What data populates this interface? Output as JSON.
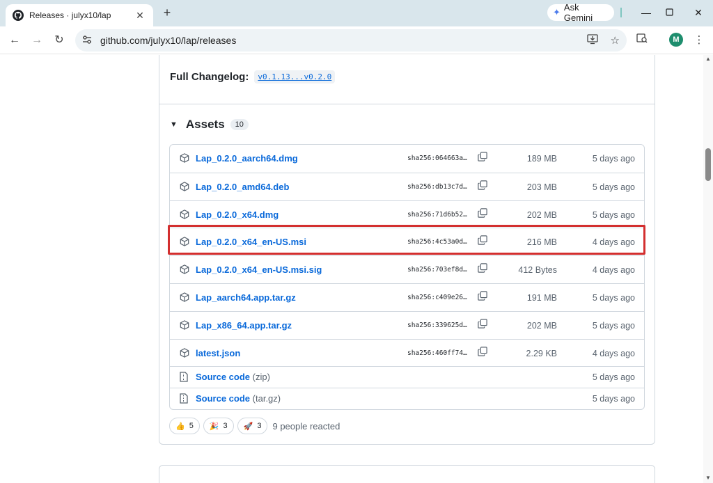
{
  "browser": {
    "tab_title": "Releases · julyx10/lap",
    "tab_close": "✕",
    "new_tab": "+",
    "ask_gemini": "Ask Gemini",
    "url": "github.com/julyx10/lap/releases",
    "avatar_letter": "M"
  },
  "release": {
    "cut_text": "",
    "changelog_label": "Full Changelog:",
    "changelog_link": "v0.1.13...v0.2.0",
    "assets_title": "Assets",
    "assets_count": "10",
    "assets": [
      {
        "name": "Lap_0.2.0_aarch64.dmg",
        "sha": "sha256:064663a…",
        "size": "189 MB",
        "date": "5 days ago"
      },
      {
        "name": "Lap_0.2.0_amd64.deb",
        "sha": "sha256:db13c7d…",
        "size": "203 MB",
        "date": "5 days ago"
      },
      {
        "name": "Lap_0.2.0_x64.dmg",
        "sha": "sha256:71d6b52…",
        "size": "202 MB",
        "date": "5 days ago"
      },
      {
        "name": "Lap_0.2.0_x64_en-US.msi",
        "sha": "sha256:4c53a0d…",
        "size": "216 MB",
        "date": "4 days ago"
      },
      {
        "name": "Lap_0.2.0_x64_en-US.msi.sig",
        "sha": "sha256:703ef8d…",
        "size": "412 Bytes",
        "date": "4 days ago"
      },
      {
        "name": "Lap_aarch64.app.tar.gz",
        "sha": "sha256:c409e26…",
        "size": "191 MB",
        "date": "5 days ago"
      },
      {
        "name": "Lap_x86_64.app.tar.gz",
        "sha": "sha256:339625d…",
        "size": "202 MB",
        "date": "5 days ago"
      },
      {
        "name": "latest.json",
        "sha": "sha256:460ff74…",
        "size": "2.29 KB",
        "date": "4 days ago"
      }
    ],
    "source_code": [
      {
        "name": "Source code",
        "ext": "(zip)",
        "date": "5 days ago"
      },
      {
        "name": "Source code",
        "ext": "(tar.gz)",
        "date": "5 days ago"
      }
    ],
    "reactions": [
      {
        "emoji": "👍",
        "count": "5"
      },
      {
        "emoji": "🎉",
        "count": "3"
      },
      {
        "emoji": "🚀",
        "count": "3"
      }
    ],
    "reaction_summary": "9 people reacted"
  },
  "colors": {
    "link": "#0969da",
    "highlight": "#d32f2f"
  }
}
